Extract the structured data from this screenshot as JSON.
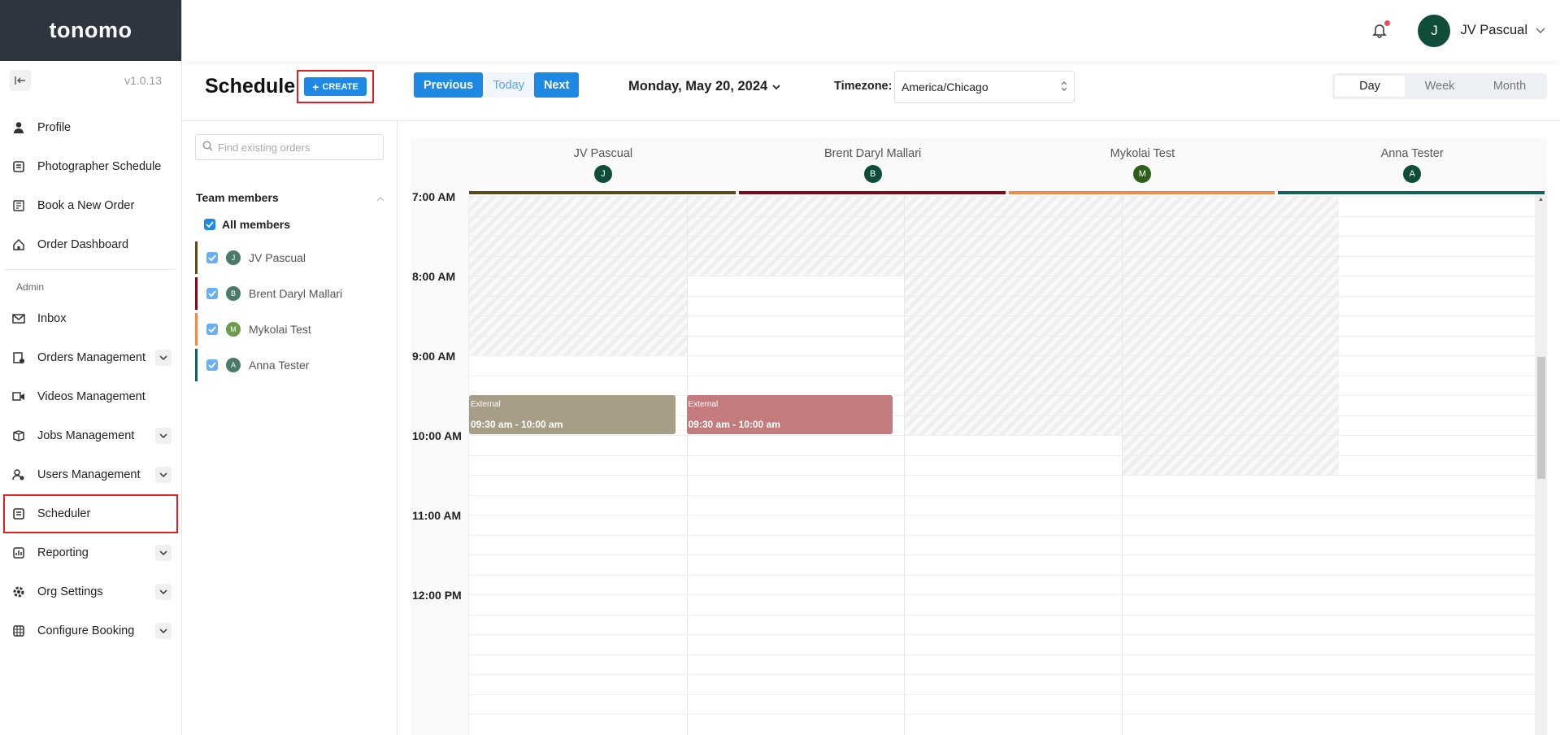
{
  "app": {
    "logo": "tonomo",
    "version": "v1.0.13"
  },
  "sidebar": {
    "items": [
      {
        "label": "Profile",
        "icon": "person-icon"
      },
      {
        "label": "Photographer Schedule",
        "icon": "schedule-icon"
      },
      {
        "label": "Book a New Order",
        "icon": "booking-icon"
      },
      {
        "label": "Order Dashboard",
        "icon": "home-icon"
      }
    ],
    "admin_label": "Admin",
    "admin_items": [
      {
        "label": "Inbox",
        "icon": "mail-icon"
      },
      {
        "label": "Orders Management",
        "icon": "orders-icon"
      },
      {
        "label": "Videos Management",
        "icon": "video-icon"
      },
      {
        "label": "Jobs Management",
        "icon": "box-icon"
      },
      {
        "label": "Users Management",
        "icon": "users-icon"
      },
      {
        "label": "Scheduler",
        "icon": "calendar-icon"
      },
      {
        "label": "Reporting",
        "icon": "report-icon"
      },
      {
        "label": "Org Settings",
        "icon": "gear-icon"
      },
      {
        "label": "Configure Booking",
        "icon": "grid-icon"
      }
    ]
  },
  "header": {
    "user_initial": "J",
    "user_name": "JV Pascual"
  },
  "toolbar": {
    "title": "Schedule",
    "create_label": "CREATE",
    "previous_label": "Previous",
    "today_label": "Today",
    "next_label": "Next",
    "date": "Monday, May 20, 2024",
    "timezone_label": "Timezone:",
    "timezone_value": "America/Chicago",
    "views": [
      "Day",
      "Week",
      "Month"
    ],
    "active_view": "Day"
  },
  "filter": {
    "search_placeholder": "Find existing orders",
    "team_label": "Team members",
    "all_label": "All members",
    "members": [
      {
        "name": "JV Pascual",
        "initial": "J",
        "color": "#5b4a1e",
        "avatar_color": "#4c7a6a"
      },
      {
        "name": "Brent Daryl Mallari",
        "initial": "B",
        "color": "#7a0c1c",
        "avatar_color": "#4c7a6a"
      },
      {
        "name": "Mykolai Test",
        "initial": "M",
        "color": "#f08a4b",
        "avatar_color": "#6b9a4a"
      },
      {
        "name": "Anna Tester",
        "initial": "A",
        "color": "#16605a",
        "avatar_color": "#4c7a6a"
      }
    ]
  },
  "calendar": {
    "columns": [
      {
        "name": "JV Pascual",
        "initial": "J",
        "bar_color": "#5b4a1e",
        "avatar_color": "#0f4c3a"
      },
      {
        "name": "Brent Daryl Mallari",
        "initial": "B",
        "bar_color": "#7a0c1c",
        "avatar_color": "#0f4c3a"
      },
      {
        "name": "Mykolai Test",
        "initial": "M",
        "bar_color": "#f08a4b",
        "avatar_color": "#2e5e1c"
      },
      {
        "name": "Anna Tester",
        "initial": "A",
        "bar_color": "#16605a",
        "avatar_color": "#0f4c3a"
      }
    ],
    "times": [
      "7:00 AM",
      "8:00 AM",
      "9:00 AM",
      "10:00 AM",
      "11:00 AM",
      "12:00 PM"
    ],
    "events": [
      {
        "title": "External",
        "time": "09:30 am - 10:00 am",
        "column": 0,
        "color": "#a89e88"
      },
      {
        "title": "External",
        "time": "09:30 am - 10:00 am",
        "column": 1,
        "color": "#c47b7d"
      }
    ]
  }
}
